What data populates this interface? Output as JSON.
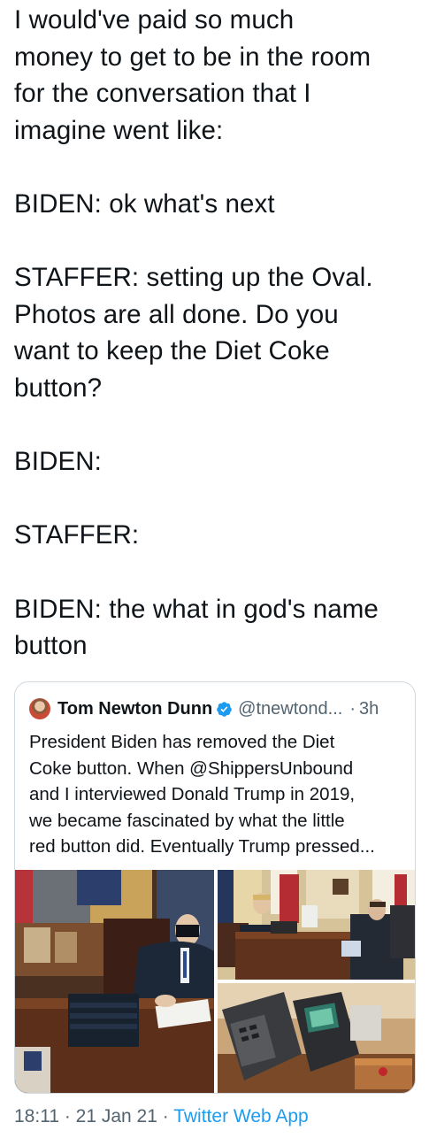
{
  "tweet": {
    "lines": [
      "I would've paid so much",
      "money to get to be in the room",
      "for the conversation that I",
      "imagine went like:",
      "",
      "BIDEN: ok what's next",
      "",
      "STAFFER: setting up the Oval.",
      "Photos are all done. Do you",
      "want to keep the Diet Coke",
      "button?",
      "",
      "BIDEN:",
      "",
      "STAFFER:",
      "",
      "BIDEN: the what in god's name",
      "button"
    ]
  },
  "quote": {
    "author_name": "Tom Newton Dunn",
    "handle": "@tnewtond...",
    "separator": "·",
    "time": "3h",
    "lines": [
      "President Biden has removed the Diet",
      "Coke button. When @ShippersUnbound",
      "and I interviewed Donald Trump in 2019,",
      "we became fascinated by what the little",
      "red button did. Eventually Trump pressed..."
    ],
    "media": [
      {
        "icon": "photo-biden-signing-at-resolute-desk"
      },
      {
        "icon": "photo-trump-interview-oval-office"
      },
      {
        "icon": "photo-desk-phones-and-button"
      }
    ]
  },
  "footer": {
    "time": "18:11",
    "sep1": " · ",
    "date": "21 Jan 21",
    "sep2": " · ",
    "app": "Twitter Web App"
  },
  "colors": {
    "text": "#0f1419",
    "secondary": "#536471",
    "link": "#1d9bf0",
    "border": "#cfd9de"
  }
}
